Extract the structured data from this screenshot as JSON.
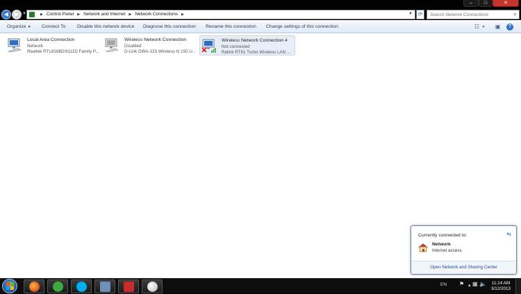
{
  "window": {
    "min_label": "–",
    "max_label": "□",
    "close_label": "✕"
  },
  "address": {
    "back_icon": "◀",
    "forward_icon": "▶",
    "crumbs": [
      "Control Panel",
      "Network and Internet",
      "Network Connections"
    ],
    "refresh_icon": "⟳",
    "search_placeholder": "Search Network Connections"
  },
  "toolbar": {
    "organize": "Organize",
    "connect_to": "Connect To",
    "disable": "Disable this network device",
    "diagnose": "Diagnose this connection",
    "rename": "Rename this connection",
    "change_settings": "Change settings of this connection"
  },
  "connections": [
    {
      "name": "Local Area Connection",
      "status": "Network",
      "device": "Realtek RTL8168D/8111D Family P...",
      "selected": false,
      "icon": "wired-network-icon"
    },
    {
      "name": "Wireless Network Connection",
      "status": "Disabled",
      "device": "D-Link DWA-123 Wireless N 150 U...",
      "selected": false,
      "icon": "wireless-network-disabled-icon"
    },
    {
      "name": "Wireless Network Connection 4",
      "status": "Not connected",
      "device": "Ralink RT61 Turbo Wireless LAN ...",
      "selected": true,
      "icon": "wireless-network-not-connected-icon"
    }
  ],
  "popup": {
    "title": "Currently connected to:",
    "network": "Network",
    "access": "Internet access",
    "link": "Open Network and Sharing Center"
  },
  "taskbar": {
    "apps": [
      "firefox-icon",
      "utorrent-icon",
      "skype-icon",
      "remote-desktop-icon",
      "network-manager-icon",
      "paint-icon"
    ],
    "language": "EN",
    "time": "11:14 AM",
    "date": "3/12/2013"
  },
  "colors": {
    "command_bar_text": "#1e395b",
    "link": "#1e4ba0",
    "taskbar": "#0d0d0d"
  }
}
